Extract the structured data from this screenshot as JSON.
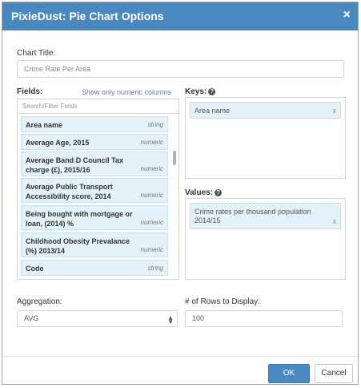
{
  "dialog": {
    "title": "PixieDust: Pie Chart Options",
    "close": "×"
  },
  "chart_title": {
    "label": "Chart Title:",
    "value": "Crime Rate Per Area"
  },
  "fields": {
    "label": "Fields:",
    "numeric_toggle": "Show only numeric columns",
    "search_placeholder": "Search/Filter Fields",
    "items": [
      {
        "name": "Area name",
        "type": "string"
      },
      {
        "name": "Average Age, 2015",
        "type": "numeric"
      },
      {
        "name": "Average Band D Council Tax charge (£), 2015/16",
        "type": "numeric"
      },
      {
        "name": "Average Public Transport Accessibility score, 2014",
        "type": "numeric"
      },
      {
        "name": "Being bought with mortgage or loan, (2014) %",
        "type": "numeric"
      },
      {
        "name": "Childhood Obesity Prevalance (%) 2013/14",
        "type": "numeric"
      },
      {
        "name": "Code",
        "type": "string"
      }
    ]
  },
  "keys": {
    "label": "Keys:",
    "items": [
      {
        "name": "Area name",
        "remove": "x"
      }
    ]
  },
  "values": {
    "label": "Values:",
    "items": [
      {
        "name": "Crime rates per thousand population 2014/15",
        "remove": "x"
      }
    ]
  },
  "aggregation": {
    "label": "Aggregation:",
    "value": "AVG"
  },
  "rows": {
    "label": "# of Rows to Display:",
    "value": "100"
  },
  "buttons": {
    "ok": "OK",
    "cancel": "Cancel"
  }
}
